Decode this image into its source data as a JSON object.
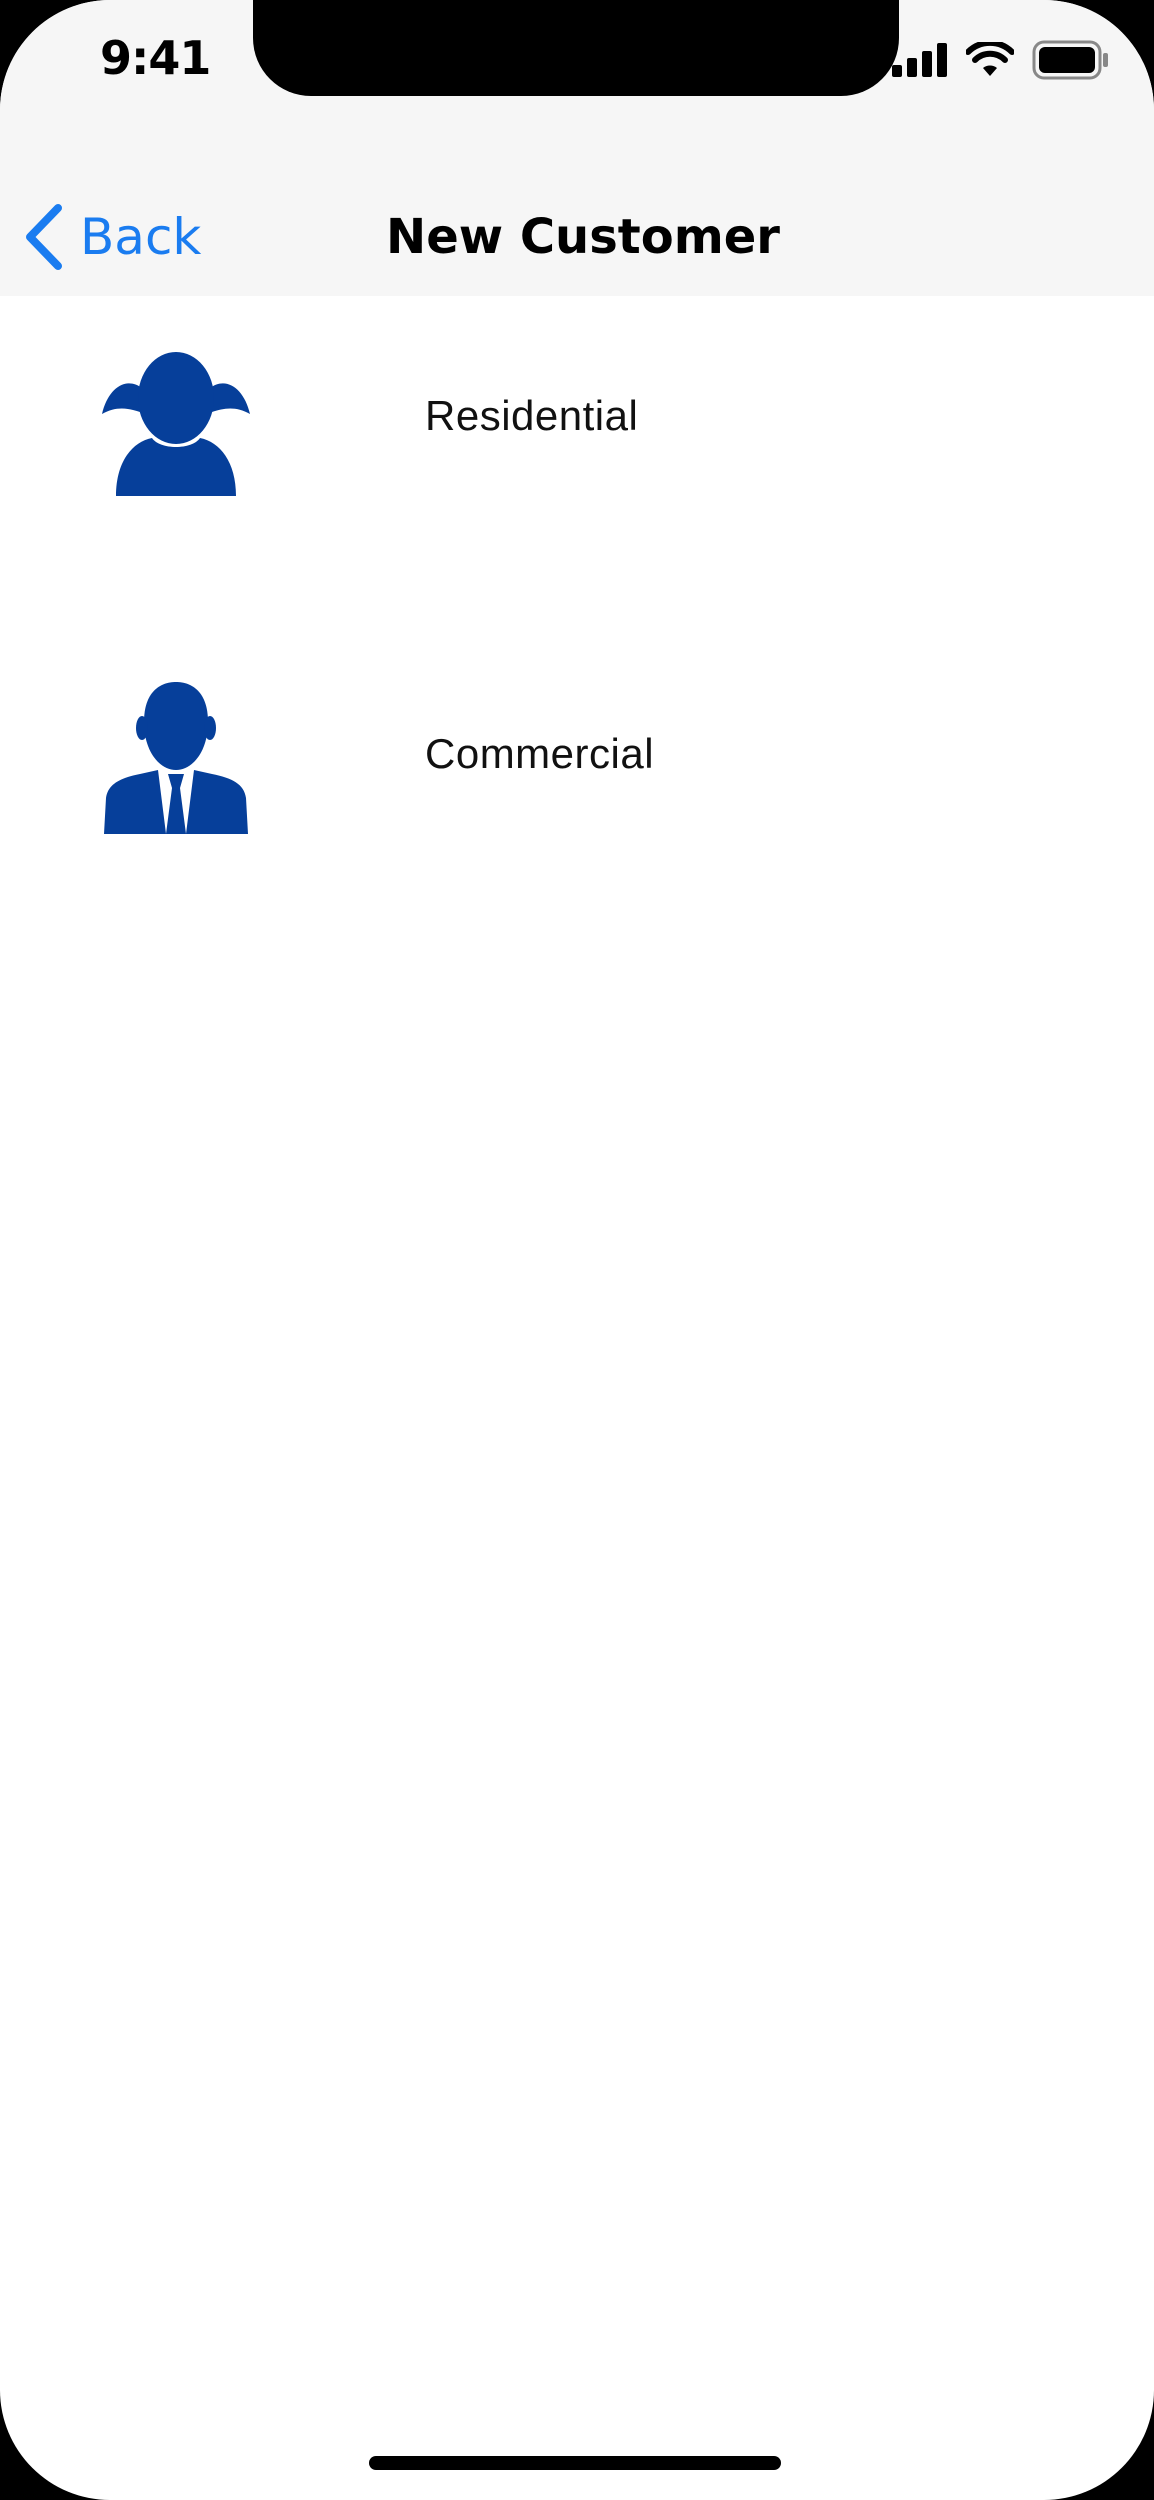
{
  "status_bar": {
    "time": "9:41",
    "icons": [
      "cellular-signal-icon",
      "wifi-icon",
      "battery-icon"
    ]
  },
  "nav": {
    "back_label": "Back",
    "title": "New Customer",
    "back_icon": "chevron-left-icon"
  },
  "customer_types": [
    {
      "label": "Residential",
      "icon": "girl-person-icon"
    },
    {
      "label": "Commercial",
      "icon": "businessman-icon"
    }
  ],
  "colors": {
    "accent": "#1a7cf0",
    "icon_blue": "#063f9a",
    "nav_background": "#f6f6f6"
  }
}
